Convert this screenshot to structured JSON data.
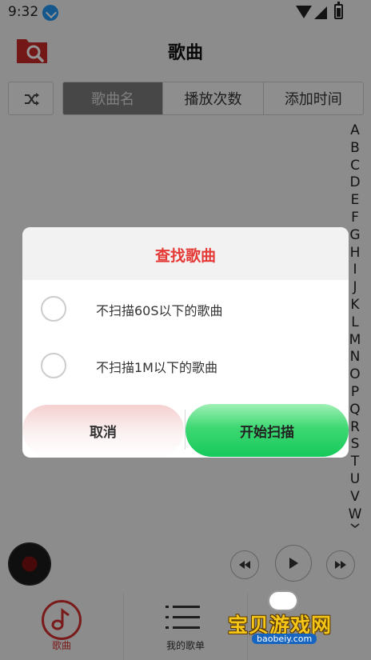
{
  "status_bar": {
    "time": "9:32"
  },
  "header": {
    "title": "歌曲"
  },
  "sort_tabs": [
    {
      "label": "歌曲名",
      "active": true
    },
    {
      "label": "播放次数",
      "active": false
    },
    {
      "label": "添加时间",
      "active": false
    }
  ],
  "alphabet": [
    "A",
    "B",
    "C",
    "D",
    "E",
    "F",
    "G",
    "H",
    "I",
    "J",
    "K",
    "L",
    "M",
    "N",
    "O",
    "P",
    "Q",
    "R",
    "S",
    "T",
    "U",
    "V",
    "W"
  ],
  "dialog": {
    "title": "查找歌曲",
    "options": [
      {
        "label": "不扫描60S以下的歌曲",
        "checked": false
      },
      {
        "label": "不扫描1M以下的歌曲",
        "checked": false
      }
    ],
    "cancel_label": "取消",
    "start_label": "开始扫描"
  },
  "bottom_nav": [
    {
      "label": "歌曲",
      "active": true
    },
    {
      "label": "我的歌单",
      "active": false
    }
  ],
  "watermark": {
    "text": "宝贝游戏网",
    "sub": "baobeiy.com"
  },
  "colors": {
    "accent_red": "#d32f2f",
    "title_red": "#e53935",
    "start_green": "#22cc5e"
  }
}
